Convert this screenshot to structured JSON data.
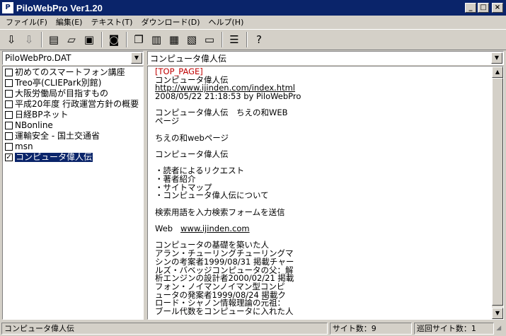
{
  "window": {
    "title": "PiloWebPro  Ver1.20",
    "icon": "app-icon"
  },
  "menubar": {
    "items": [
      "ファイル(F)",
      "編集(E)",
      "テキスト(T)",
      "ダウンロード(D)",
      "ヘルプ(H)"
    ]
  },
  "toolbar": {
    "icons": [
      "arrow-down-icon",
      "arrow-down-gray-icon",
      "document-icon",
      "open-folder-icon",
      "save-icon",
      "binoculars-icon",
      "copy-icon",
      "page-icon",
      "edit-page-icon",
      "delete-page-icon",
      "monitor-icon",
      "list-icon",
      "help-icon"
    ]
  },
  "file_combo": {
    "value": "PiloWebPro.DAT"
  },
  "site_combo": {
    "value": "コンピュータ偉人伝"
  },
  "sites": [
    {
      "label": "初めてのスマートフォン講座",
      "checked": false
    },
    {
      "label": "Treo亭(CLIEPark別館)",
      "checked": false
    },
    {
      "label": "大阪労働局が目指すもの",
      "checked": false
    },
    {
      "label": "平成20年度 行政運営方針の概要",
      "checked": false
    },
    {
      "label": "日経BPネット",
      "checked": false
    },
    {
      "label": "NBonline",
      "checked": false
    },
    {
      "label": "運輸安全 - 国土交通省",
      "checked": false
    },
    {
      "label": "msn",
      "checked": false
    },
    {
      "label": "コンピュータ偉人伝",
      "checked": true
    }
  ],
  "content": {
    "tag": "[TOP_PAGE]",
    "title": "コンピュータ偉人伝",
    "url": "http://www.ijinden.com/index.html",
    "timestamp": "2008/05/22 21:18:53 by PiloWebPro",
    "line1": "コンピュータ偉人伝　ちえの和WEB",
    "line2": "ページ",
    "line3": "ちえの和webページ",
    "line4": "コンピュータ偉人伝",
    "bullet1": "・読者によるリクエスト",
    "bullet2": "・著者紹介",
    "bullet3": "・サイトマップ",
    "bullet4": "・コンピュータ偉人伝について",
    "line5": "検索用語を入力検索フォームを送信",
    "web_label": "Web",
    "web_link": "www.ijinden.com",
    "p1": "コンピュータの基礎を築いた人",
    "p2": "アラン・チューリングチューリングマ",
    "p3": "シンの考案者1999/08/31 掲載チャー",
    "p4": "ルズ・バベッジコンピュータの父：解",
    "p5": "析エンジンの設計者2000/02/21 掲載",
    "p6": "フォン・ノイマンノイマン型コンピ",
    "p7": "ュータの発案者1999/08/24 掲載ク",
    "p8": "ロード・シャノン情報理論の元祖：",
    "p9": "ブール代数をコンピュータに入れた人"
  },
  "status": {
    "main": "コンピュータ偉人伝",
    "site_count": "サイト数：9",
    "cycle_count": "巡回サイト数：1"
  }
}
